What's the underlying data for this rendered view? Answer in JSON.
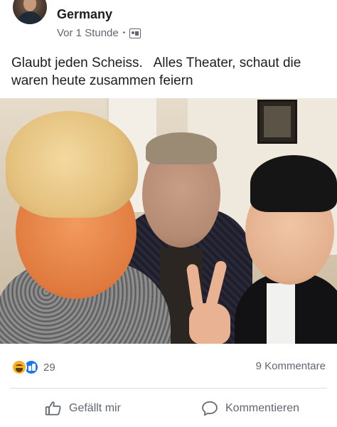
{
  "post": {
    "group_name": "Germany",
    "time": "Vor 1 Stunde",
    "privacy_icon": "group-icon",
    "text": "Glaubt jeden Scheiss.   Alles Theater, schaut die waren heute zusammen feiern"
  },
  "photo": {
    "alt": "selfie-photo"
  },
  "footer": {
    "reaction_icons": [
      "haha-icon",
      "like-icon"
    ],
    "reaction_count": "29",
    "comments_count": "9 Kommentare",
    "like_label": "Gefällt mir",
    "comment_label": "Kommentieren"
  },
  "colors": {
    "text": "#1c1e21",
    "secondary": "#606770",
    "like_blue": "#1877f2",
    "haha_yellow": "#f7b125",
    "divider": "#dadde1"
  }
}
